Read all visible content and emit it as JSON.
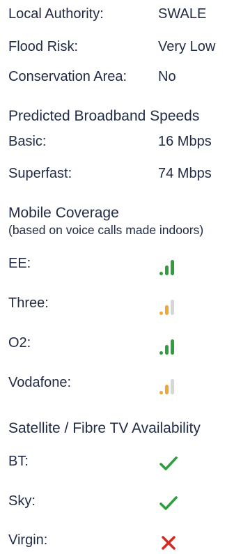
{
  "property_info": {
    "local_authority": {
      "label": "Local Authority:",
      "value": "SWALE"
    },
    "flood_risk": {
      "label": "Flood Risk:",
      "value": "Very Low"
    },
    "conservation_area": {
      "label": "Conservation Area:",
      "value": "No"
    }
  },
  "broadband": {
    "heading": "Predicted Broadband Speeds",
    "basic": {
      "label": "Basic:",
      "value": "16 Mbps"
    },
    "superfast": {
      "label": "Superfast:",
      "value": "74 Mbps"
    }
  },
  "mobile": {
    "heading": "Mobile Coverage",
    "subheading": "(based on voice calls made indoors)",
    "carriers": [
      {
        "label": "EE:",
        "signal": 3,
        "icon": "signal-strong-icon",
        "color": "#2e9e3e"
      },
      {
        "label": "Three:",
        "signal": 2,
        "icon": "signal-medium-icon",
        "color": "#f0a830"
      },
      {
        "label": "O2:",
        "signal": 3,
        "icon": "signal-strong-icon",
        "color": "#2e9e3e"
      },
      {
        "label": "Vodafone:",
        "signal": 2,
        "icon": "signal-medium-icon",
        "color": "#f0a830"
      }
    ]
  },
  "tv": {
    "heading": "Satellite / Fibre TV Availability",
    "providers": [
      {
        "label": "BT:",
        "available": true,
        "icon": "check-icon",
        "color": "#2e9e3e"
      },
      {
        "label": "Sky:",
        "available": true,
        "icon": "check-icon",
        "color": "#2e9e3e"
      },
      {
        "label": "Virgin:",
        "available": false,
        "icon": "cross-icon",
        "color": "#d62b1f"
      }
    ]
  },
  "colors": {
    "text": "#1f2a44",
    "bar_inactive": "#d6d6d6"
  }
}
